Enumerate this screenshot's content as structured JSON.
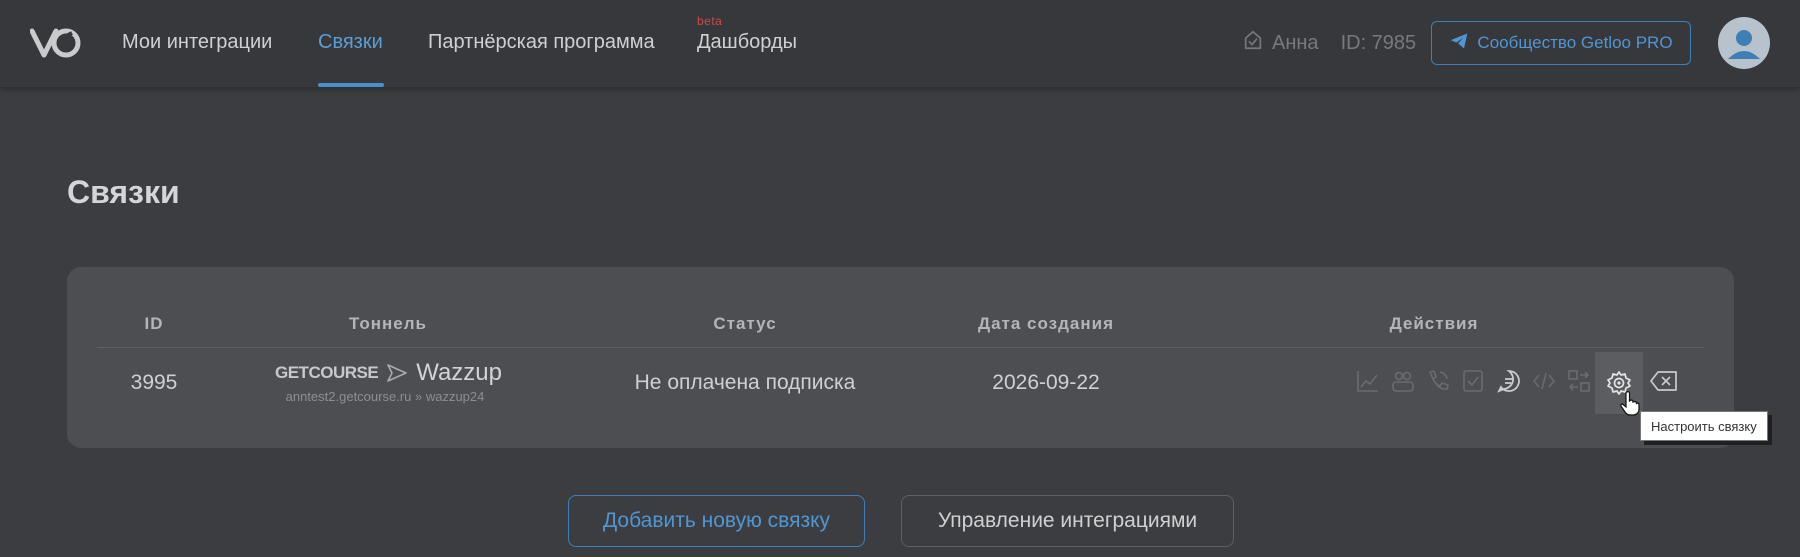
{
  "nav": {
    "items": [
      {
        "label": "Мои интеграции"
      },
      {
        "label": "Связки"
      },
      {
        "label": "Партнёрская программа"
      },
      {
        "label": "Дашборды"
      }
    ],
    "beta_badge": "beta"
  },
  "user": {
    "name": "Анна",
    "id_label": "ID: 7985"
  },
  "community_button": "Сообщество Getloo PRO",
  "page": {
    "title": "Связки"
  },
  "table": {
    "headers": [
      "ID",
      "Тоннель",
      "Статус",
      "Дата создания",
      "Действия"
    ],
    "rows": [
      {
        "id": "3995",
        "tunnel_from": "GETCOURSE",
        "tunnel_to": "Wazzup",
        "tunnel_sub": "anntest2.getcourse.ru » wazzup24",
        "status": "Не оплачена подписка",
        "created": "2026-09-22"
      }
    ]
  },
  "tooltip": "Настроить связку",
  "buttons": {
    "add": "Добавить новую связку",
    "manage": "Управление интеграциями"
  },
  "colors": {
    "accent": "#4f96d3",
    "background": "#3c3d40",
    "card": "#4d4e51"
  },
  "icons": [
    "chart-icon",
    "users-icon",
    "phone-icon",
    "check-doc-icon",
    "chat-icon",
    "code-icon",
    "transfer-icon",
    "settings-icon",
    "delete-icon"
  ]
}
